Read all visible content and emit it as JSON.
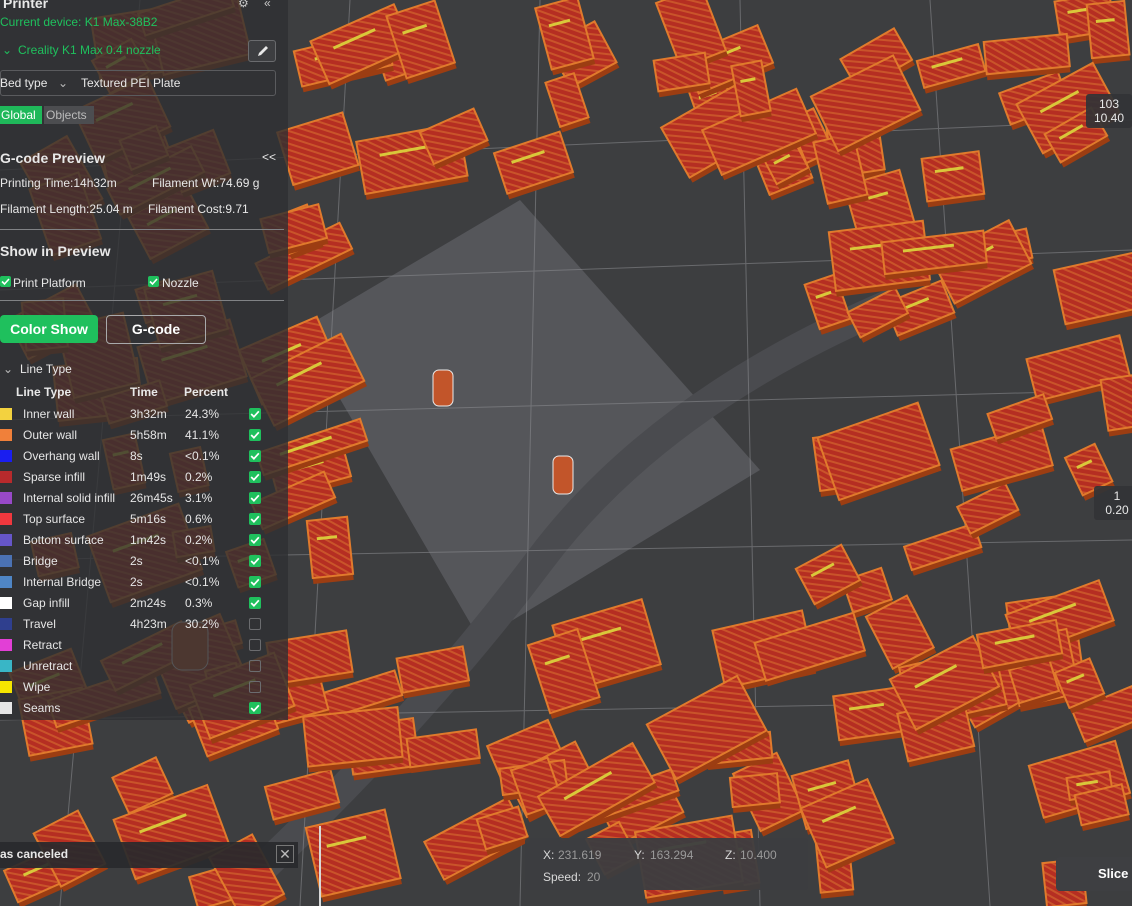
{
  "app": {
    "accent_color": "#1fc05d"
  },
  "printer": {
    "title": "Printer",
    "current_device": "Current device: K1 Max-38B2",
    "preset": "Creality K1 Max 0.4 nozzle",
    "bed_type_label": "Bed type",
    "bed_type_value": "Textured PEI Plate",
    "tabs": [
      "Global",
      "Objects"
    ]
  },
  "gcode_preview": {
    "title": "G-code Preview",
    "printing_time": "Printing Time:14h32m",
    "filament_weight": "Filament Wt:74.69 g",
    "filament_length": "Filament Length:25.04 m",
    "filament_cost": "Filament Cost:9.71",
    "collapse_glyph": "<<"
  },
  "show_in_preview": {
    "title": "Show in Preview",
    "print_platform": "Print Platform",
    "nozzle": "Nozzle",
    "color_show": "Color Show",
    "gcode": "G-code",
    "line_type_dropdown": "Line Type"
  },
  "line_table": {
    "headers": [
      "Line Type",
      "Time",
      "Percent"
    ],
    "rows": [
      {
        "name": "Inner wall",
        "time": "3h32m",
        "percent": "24.3%",
        "color": "#f3d23f",
        "checked": true
      },
      {
        "name": "Outer wall",
        "time": "5h58m",
        "percent": "41.1%",
        "color": "#f0803a",
        "checked": true
      },
      {
        "name": "Overhang wall",
        "time": "8s",
        "percent": "<0.1%",
        "color": "#1a1ef0",
        "checked": true
      },
      {
        "name": "Sparse infill",
        "time": "1m49s",
        "percent": "0.2%",
        "color": "#b72a2c",
        "checked": true
      },
      {
        "name": "Internal solid infill",
        "time": "26m45s",
        "percent": "3.1%",
        "color": "#9849c8",
        "checked": true
      },
      {
        "name": "Top surface",
        "time": "5m16s",
        "percent": "0.6%",
        "color": "#f0383e",
        "checked": true
      },
      {
        "name": "Bottom surface",
        "time": "1m42s",
        "percent": "0.2%",
        "color": "#6656c8",
        "checked": true
      },
      {
        "name": "Bridge",
        "time": "2s",
        "percent": "<0.1%",
        "color": "#4b72b3",
        "checked": true
      },
      {
        "name": "Internal Bridge",
        "time": "2s",
        "percent": "<0.1%",
        "color": "#4f86c6",
        "checked": true
      },
      {
        "name": "Gap infill",
        "time": "2m24s",
        "percent": "0.3%",
        "color": "#ffffff",
        "checked": true
      },
      {
        "name": "Travel",
        "time": "4h23m",
        "percent": "30.2%",
        "color": "#2f3f8e",
        "checked": false
      },
      {
        "name": "Retract",
        "time": "",
        "percent": "",
        "color": "#e23fd6",
        "checked": false
      },
      {
        "name": "Unretract",
        "time": "",
        "percent": "",
        "color": "#39b6c6",
        "checked": false
      },
      {
        "name": "Wipe",
        "time": "",
        "percent": "",
        "color": "#f6e600",
        "checked": false
      },
      {
        "name": "Seams",
        "time": "",
        "percent": "",
        "color": "#e6e6e6",
        "checked": true
      }
    ]
  },
  "layer_slider": {
    "top_layer": "103",
    "top_height": "10.40",
    "bottom_layer": "1",
    "bottom_height": "0.20"
  },
  "coordinates": {
    "x_label": "X:",
    "x_value": "231.619",
    "y_label": "Y:",
    "y_value": "163.294",
    "z_label": "Z:",
    "z_value": "10.400",
    "speed_label": "Speed:",
    "speed_value": "20"
  },
  "notification": {
    "text": "as canceled"
  },
  "slice_button": "Slice"
}
